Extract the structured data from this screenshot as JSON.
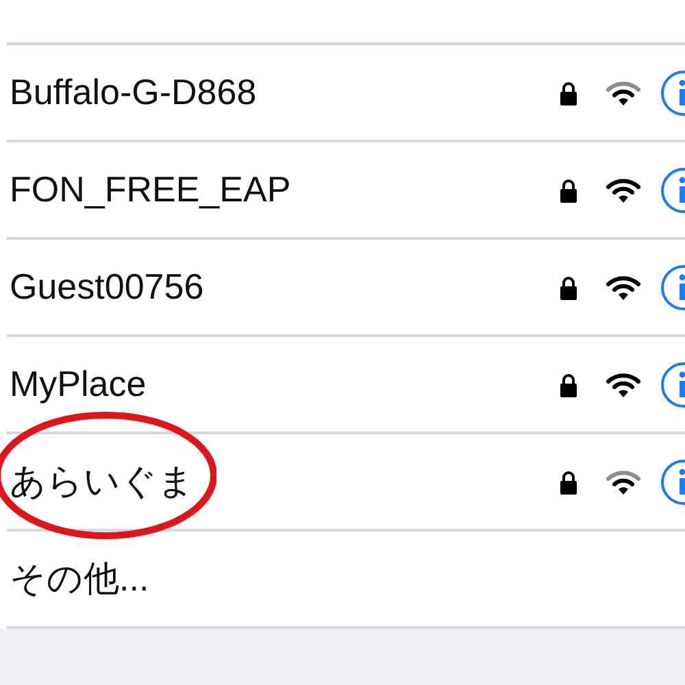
{
  "networks": [
    {
      "name": "Buffalo-G-D868",
      "secured": true,
      "signal_full": false,
      "circled": false
    },
    {
      "name": "FON_FREE_EAP",
      "secured": true,
      "signal_full": true,
      "circled": false
    },
    {
      "name": "Guest00756",
      "secured": true,
      "signal_full": true,
      "circled": false
    },
    {
      "name": "MyPlace",
      "secured": true,
      "signal_full": true,
      "circled": false
    },
    {
      "name": "あらいぐま",
      "secured": true,
      "signal_full": false,
      "circled": true
    }
  ],
  "other": {
    "label": "その他..."
  }
}
